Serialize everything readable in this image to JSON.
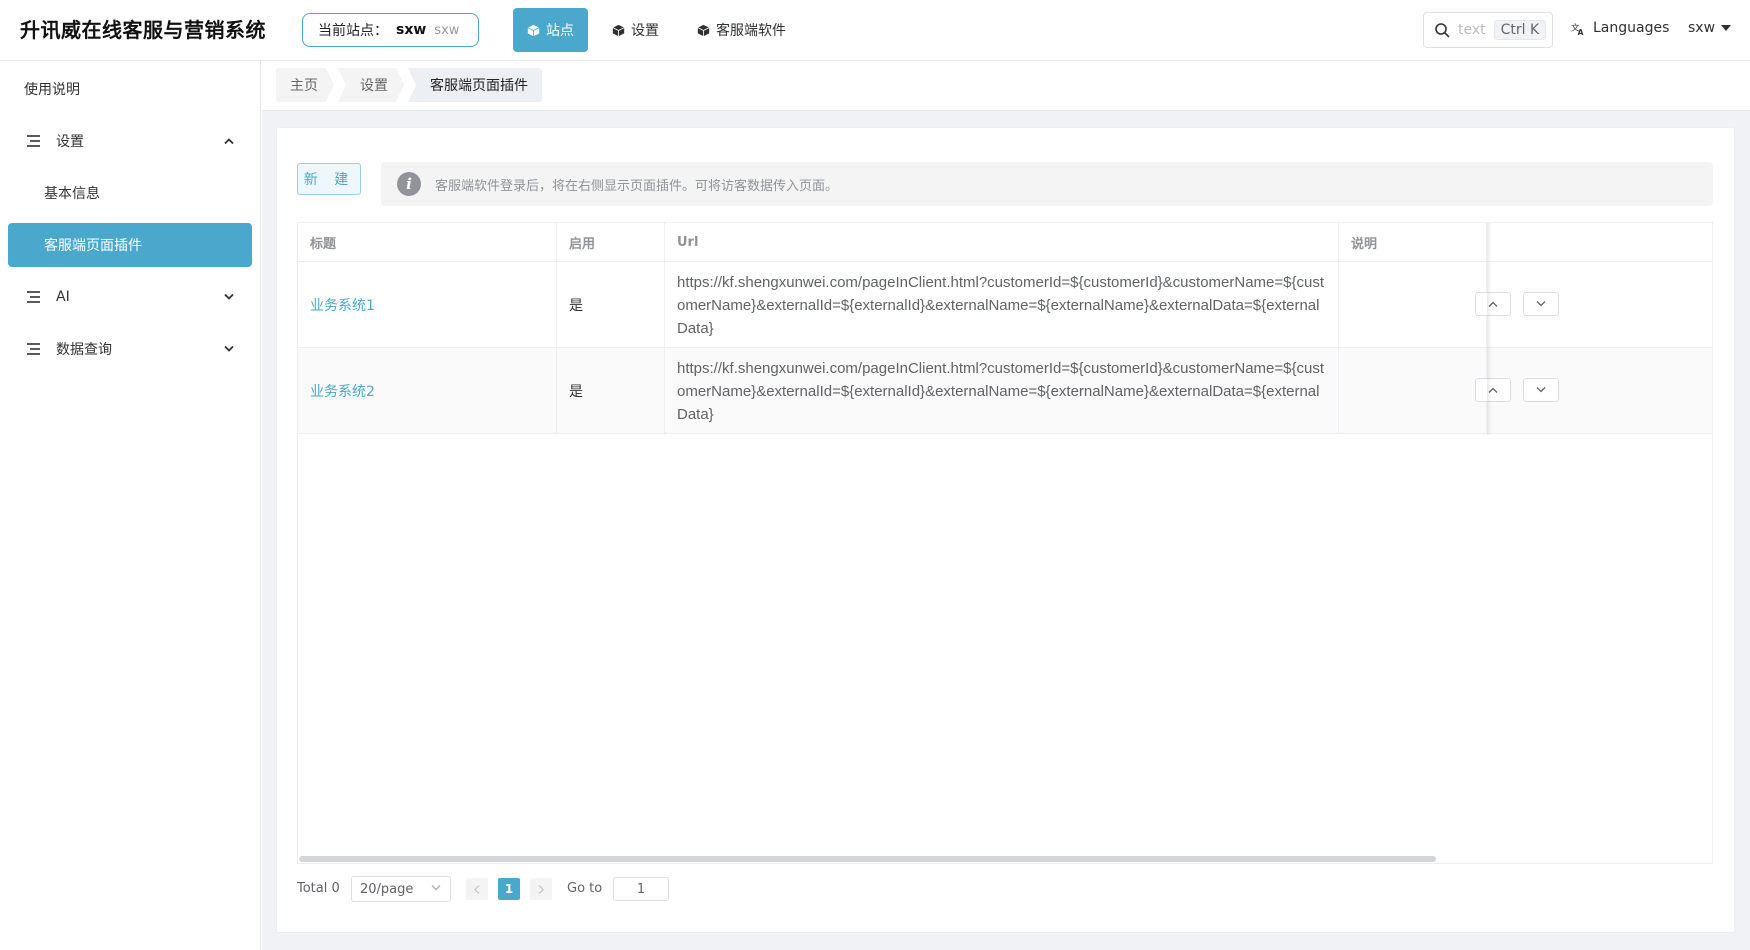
{
  "app": {
    "title": "升讯威在线客服与营销系统"
  },
  "site": {
    "label": "当前站点：",
    "value": "sxw",
    "sub": "sxw"
  },
  "nav": [
    {
      "label": "站点",
      "icon": "cube-icon",
      "active": true
    },
    {
      "label": "设置",
      "icon": "cube-icon",
      "active": false
    },
    {
      "label": "客服端软件",
      "icon": "cube-icon",
      "active": false
    }
  ],
  "search": {
    "placeholder": "text",
    "shortcut": "Ctrl K"
  },
  "languages": {
    "label": "Languages"
  },
  "user": {
    "name": "sxw"
  },
  "sidebar": {
    "items": [
      {
        "label": "使用说明"
      },
      {
        "label": "设置",
        "expanded": true
      },
      {
        "label": "基本信息"
      },
      {
        "label": "客服端页面插件",
        "active": true
      },
      {
        "label": "AI",
        "expanded": false
      },
      {
        "label": "数据查询",
        "expanded": false
      }
    ]
  },
  "breadcrumb": [
    "主页",
    "设置",
    "客服端页面插件"
  ],
  "toolbar": {
    "new_label": "新 建"
  },
  "alert": {
    "message": "客服端软件登录后，将在右侧显示页面插件。可将访客数据传入页面。"
  },
  "table": {
    "columns": [
      "标题",
      "启用",
      "Url",
      "说明",
      ""
    ],
    "rows": [
      {
        "title": "业务系统1",
        "enabled": "是",
        "url": "https://kf.shengxunwei.com/pageInClient.html?customerId=${customerId}&customerName=${customerName}&externalId=${externalId}&externalName=${externalName}&externalData=${externalData}",
        "note": ""
      },
      {
        "title": "业务系统2",
        "enabled": "是",
        "url": "https://kf.shengxunwei.com/pageInClient.html?customerId=${customerId}&customerName=${customerName}&externalId=${externalId}&externalName=${externalName}&externalData=${externalData}",
        "note": ""
      }
    ]
  },
  "pagination": {
    "total": "Total 0",
    "page_size": "20/page",
    "current_page": "1",
    "goto_label": "Go to",
    "goto_value": "1"
  },
  "colors": {
    "accent": "#4aa8cc",
    "bg": "#f0f2f5",
    "border": "#ebeef5"
  }
}
